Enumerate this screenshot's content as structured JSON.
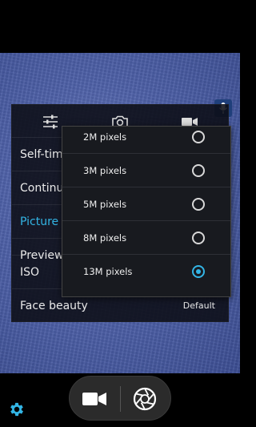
{
  "settings": {
    "rows": [
      {
        "label": "Self-timer",
        "value": ""
      },
      {
        "label": "Continuous",
        "value": ""
      },
      {
        "label": "Picture size",
        "value": ""
      },
      {
        "label": "Preview size",
        "value": ""
      },
      {
        "label": "ISO",
        "value": ""
      },
      {
        "label": "Face beauty",
        "value": "Default"
      }
    ]
  },
  "picture_size_popup": {
    "options": [
      {
        "label": "2M pixels",
        "selected": false
      },
      {
        "label": "3M pixels",
        "selected": false
      },
      {
        "label": "5M pixels",
        "selected": false
      },
      {
        "label": "8M pixels",
        "selected": false
      },
      {
        "label": "13M pixels",
        "selected": true
      }
    ]
  },
  "colors": {
    "accent": "#33b5e5",
    "panel_bg": "#0c0e16",
    "viewfinder": "#5063ab"
  },
  "icons": {
    "tab_general": "sliders-icon",
    "tab_camera": "camera-icon",
    "tab_video": "video-camera-icon",
    "mic": "microphone-icon",
    "settings": "gear-icon",
    "mode_video": "video-camera-icon",
    "shutter": "shutter-icon"
  }
}
